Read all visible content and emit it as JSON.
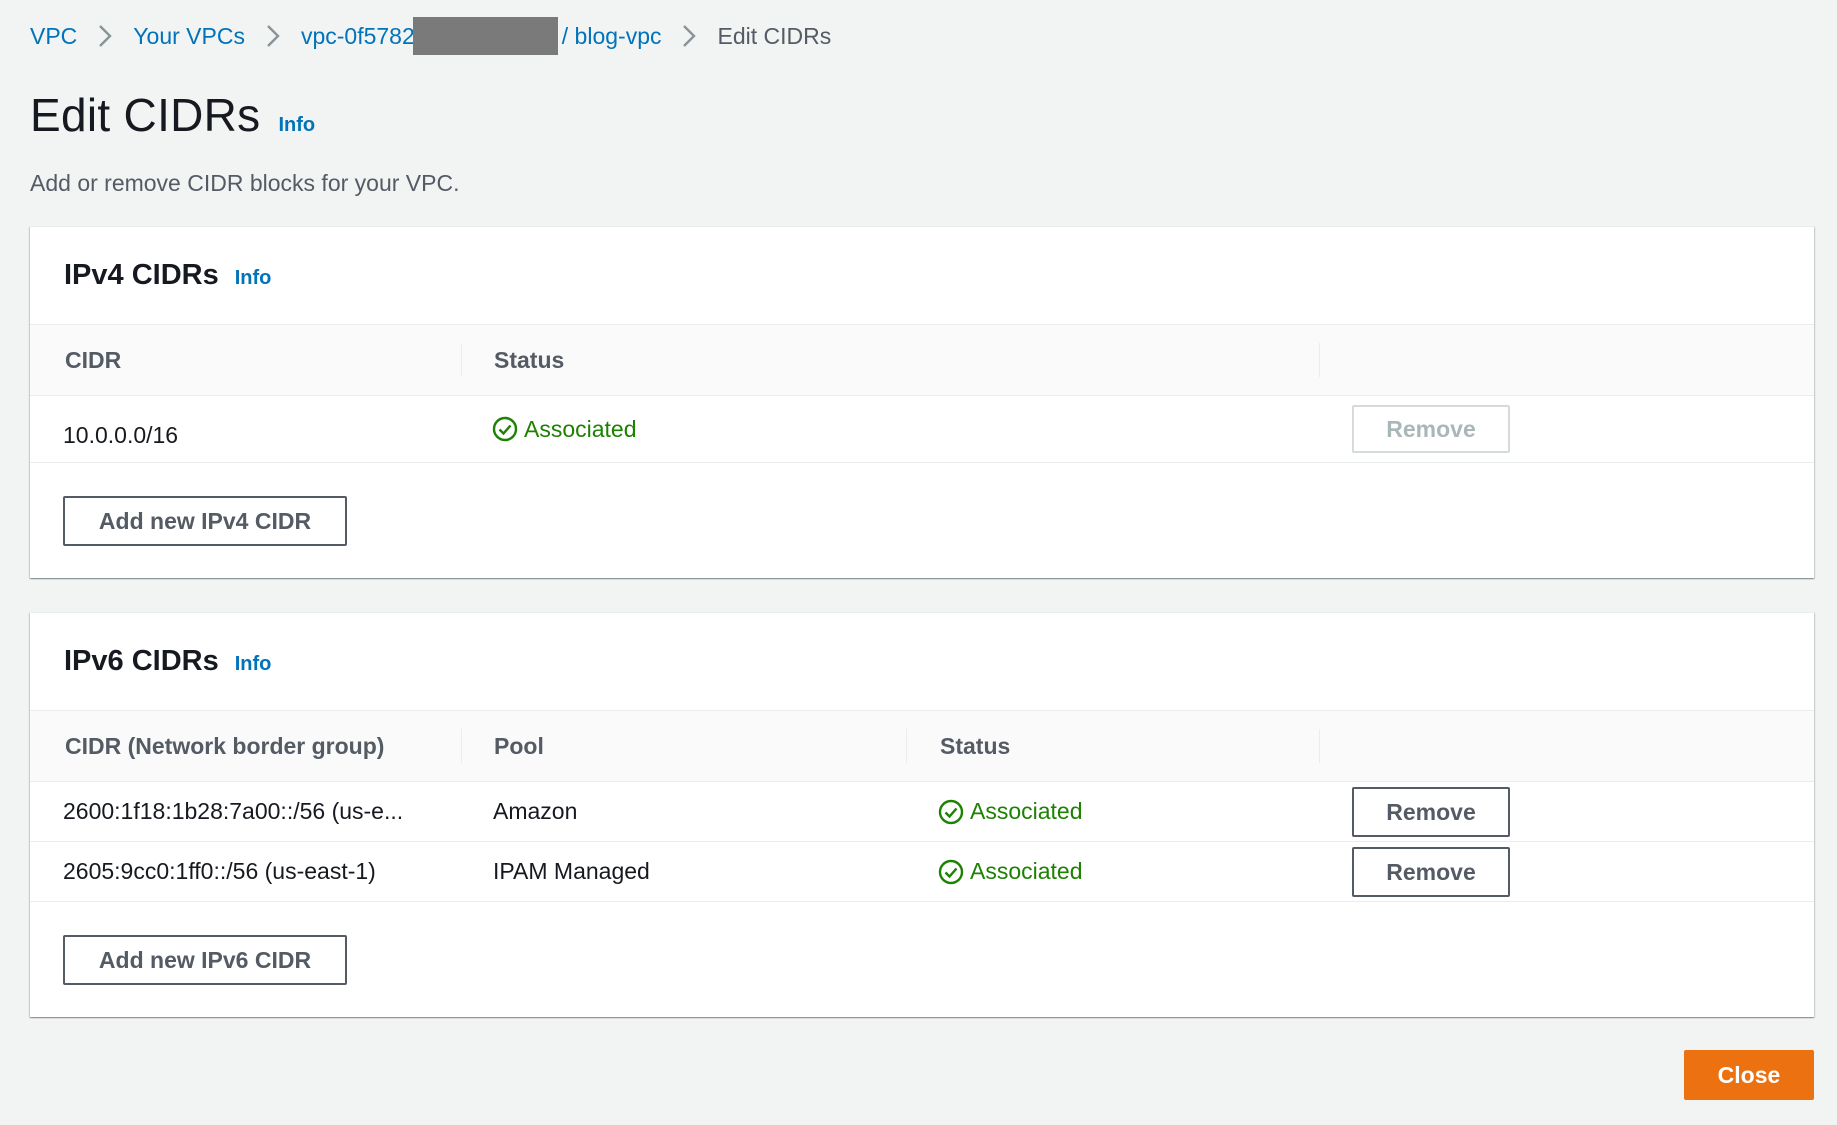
{
  "breadcrumb": {
    "items": [
      "VPC",
      "Your VPCs",
      "vpc-0f5782",
      "/ blog-vpc"
    ],
    "current": "Edit CIDRs"
  },
  "header": {
    "title": "Edit CIDRs",
    "info": "Info",
    "description": "Add or remove CIDR blocks for your VPC."
  },
  "ipv4": {
    "title": "IPv4 CIDRs",
    "info": "Info",
    "columns": [
      "CIDR",
      "Status"
    ],
    "rows": [
      {
        "cidr": "10.0.0.0/16",
        "status": "Associated",
        "action": "Remove"
      }
    ],
    "add_label": "Add new IPv4 CIDR"
  },
  "ipv6": {
    "title": "IPv6 CIDRs",
    "info": "Info",
    "columns": [
      "CIDR (Network border group)",
      "Pool",
      "Status"
    ],
    "rows": [
      {
        "cidr": "2600:1f18:1b28:7a00::/56 (us-e...",
        "pool": "Amazon",
        "status": "Associated",
        "action": "Remove"
      },
      {
        "cidr": "2605:9cc0:1ff0::/56 (us-east-1)",
        "pool": "IPAM Managed",
        "status": "Associated",
        "action": "Remove"
      }
    ],
    "add_label": "Add new IPv6 CIDR"
  },
  "footer": {
    "close_label": "Close"
  },
  "colors": {
    "link": "#0073bb",
    "success": "#1d8102",
    "primary": "#ec7211"
  }
}
